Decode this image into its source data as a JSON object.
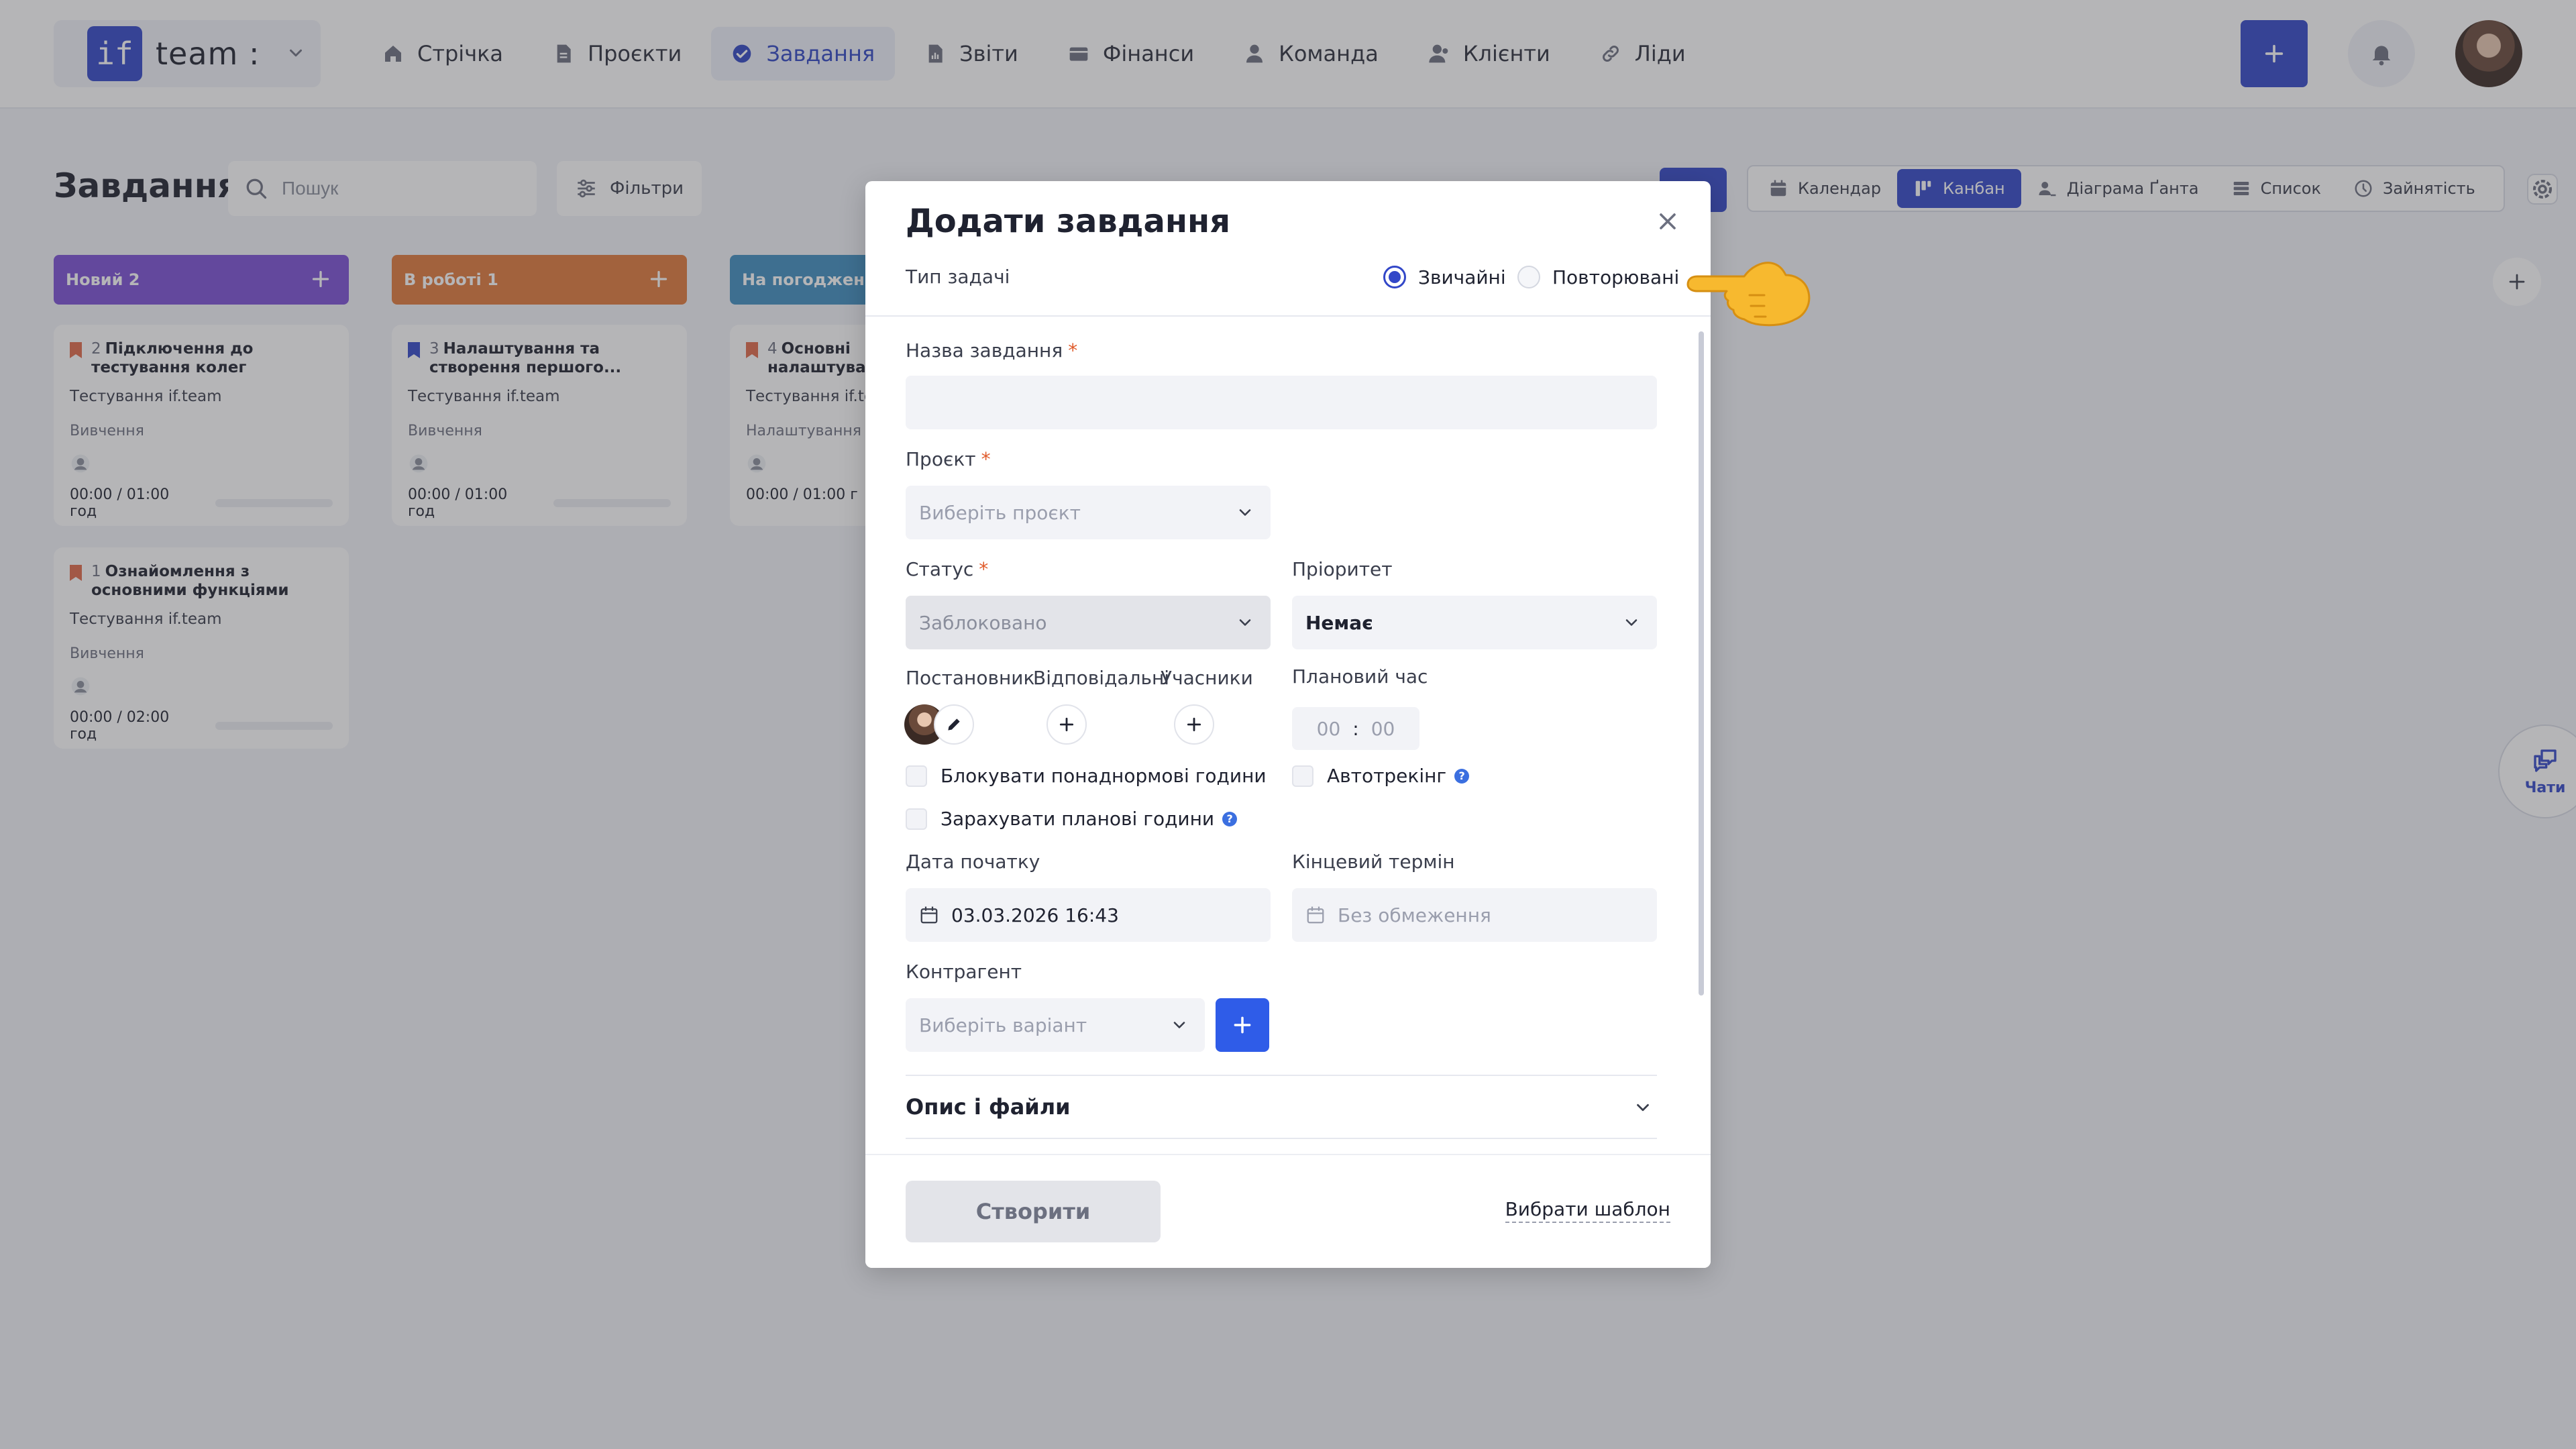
{
  "header": {
    "brand_logo": "if",
    "brand_name": "team :",
    "nav": [
      {
        "label": "Стрічка",
        "icon": "home-icon"
      },
      {
        "label": "Проєкти",
        "icon": "document-icon"
      },
      {
        "label": "Завдання",
        "icon": "check-circle-icon",
        "active": true
      },
      {
        "label": "Звіти",
        "icon": "report-icon"
      },
      {
        "label": "Фінанси",
        "icon": "wallet-icon"
      },
      {
        "label": "Команда",
        "icon": "person-icon"
      },
      {
        "label": "Клієнти",
        "icon": "clients-icon"
      },
      {
        "label": "Ліди",
        "icon": "link-icon"
      }
    ]
  },
  "page": {
    "title": "Завдання",
    "search_placeholder": "Пошук",
    "filters_label": "Фільтри",
    "views": [
      {
        "label": "Календар",
        "icon": "calendar-icon"
      },
      {
        "label": "Канбан",
        "icon": "kanban-icon",
        "active": true
      },
      {
        "label": "Діаграма Ґанта",
        "icon": "gantt-icon"
      },
      {
        "label": "Список",
        "icon": "list-icon"
      },
      {
        "label": "Зайнятість",
        "icon": "clock-icon"
      }
    ]
  },
  "kanban": {
    "columns": [
      {
        "title": "Новий",
        "count": "2",
        "color": "#7b4fd6"
      },
      {
        "title": "В роботі",
        "count": "1",
        "color": "#e07a3a"
      },
      {
        "title": "На погодженні",
        "count": "",
        "color": "#3f8fc0"
      }
    ],
    "cards": [
      {
        "num": "2",
        "title": "Підключення до тестування колег",
        "project": "Тестування if.team",
        "stage": "Вивчення",
        "time": "00:00 / 01:00 год",
        "flag": "#e06a4a"
      },
      {
        "num": "1",
        "title": "Ознайомлення з основними функціями",
        "project": "Тестування if.team",
        "stage": "Вивчення",
        "time": "00:00 / 02:00 год",
        "flag": "#e06a4a"
      },
      {
        "num": "3",
        "title": "Налаштування та створення першого...",
        "project": "Тестування if.team",
        "stage": "Вивчення",
        "time": "00:00 / 01:00 год",
        "flag": "#3247c8"
      },
      {
        "num": "4",
        "title": "Основні налаштуван",
        "project": "Тестування if.te",
        "stage": "Налаштування",
        "time": "00:00 / 01:00 г",
        "flag": "#e06a4a"
      }
    ]
  },
  "chats_label": "Чати",
  "modal": {
    "title": "Додати завдання",
    "type_label": "Тип задачі",
    "type_options": [
      {
        "label": "Звичайні",
        "checked": true
      },
      {
        "label": "Повторювані",
        "checked": false
      }
    ],
    "task_name_label": "Назва завдання",
    "task_name_value": "",
    "project_label": "Проєкт",
    "project_placeholder": "Виберіть проєкт",
    "status_label": "Статус",
    "status_value": "Заблоковано",
    "priority_label": "Пріоритет",
    "priority_value": "Немає",
    "assigner_label": "Постановник",
    "responsible_label": "Відповідальні",
    "participants_label": "Учасники",
    "planned_time_label": "Плановий час",
    "planned_hours": "00",
    "planned_minutes": "00",
    "block_overtime_label": "Блокувати понаднормові години",
    "autotracking_label": "Автотрекінг",
    "count_planned_label": "Зарахувати планові години",
    "start_date_label": "Дата початку",
    "start_date_value": "03.03.2026 16:43",
    "deadline_label": "Кінцевий термін",
    "deadline_placeholder": "Без обмеження",
    "contractor_label": "Контрагент",
    "contractor_placeholder": "Виберіть варіант",
    "description_label": "Опис і файли",
    "create_label": "Створити",
    "template_label": "Вибрати шаблон"
  },
  "colors": {
    "accent": "#3247c8",
    "bright_blue": "#2f5ce8",
    "required": "#e05a2a"
  }
}
